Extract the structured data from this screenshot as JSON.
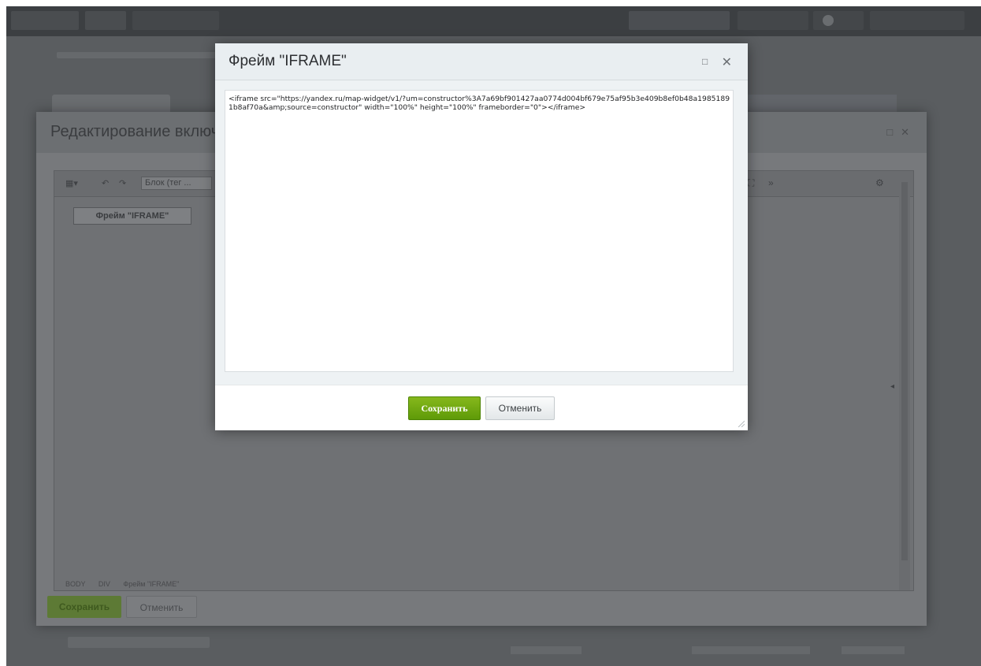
{
  "background_editor": {
    "title": "Редактирование включ",
    "toolbar": {
      "undo": "↶",
      "redo": "↷",
      "block_select": "Блок (тег ...",
      "fullscreen": "⛶",
      "more": "»",
      "settings": "⚙"
    },
    "frame_placeholder": "Фрейм \"IFRAME\"",
    "status_path": [
      "BODY",
      "DIV",
      "Фрейм \"IFRAME\""
    ],
    "save_label": "Сохранить",
    "cancel_label": "Отменить"
  },
  "modal": {
    "title": "Фрейм \"IFRAME\"",
    "code": "<iframe src=\"https://yandex.ru/map-widget/v1/?um=constructor%3A7a69bf901427aa0774d004bf679e75af95b3e409b8ef0b48a19851891b8af70a&amp;source=constructor\" width=\"100%\" height=\"100%\" frameborder=\"0\"></iframe>",
    "save_label": "Сохранить",
    "cancel_label": "Отменить"
  },
  "colors": {
    "overlay": "#5a5d60",
    "modal_header": "#e9eef1",
    "save_green": "#6aa512"
  }
}
